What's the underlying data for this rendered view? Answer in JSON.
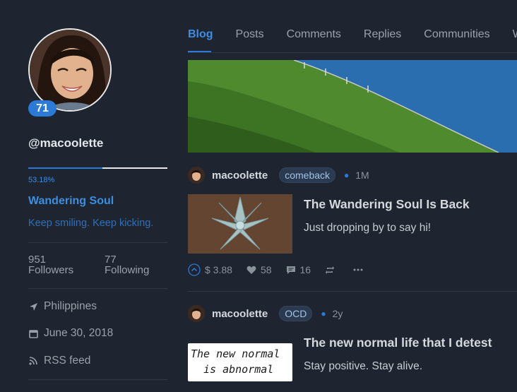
{
  "profile": {
    "reputation": "71",
    "username": "@macoolette",
    "voting_power": 0.5318,
    "voting_power_label": "53.18%",
    "name": "Wandering Soul",
    "about": "Keep smiling. Keep kicking.",
    "followers_count": "951",
    "followers_label": "Followers",
    "following_count": "77",
    "following_label": "Following",
    "location": "Philippines",
    "joined": "June 30, 2018",
    "rss": "RSS feed"
  },
  "tabs": [
    "Blog",
    "Posts",
    "Comments",
    "Replies",
    "Communities",
    "W"
  ],
  "posts": [
    {
      "author": "macoolette",
      "community": "comeback",
      "age": "1M",
      "title": "The Wandering Soul Is Back",
      "body": "Just dropping by to say hi!",
      "payout": "$ 3.88",
      "votes": "58",
      "comments": "16"
    },
    {
      "author": "macoolette",
      "community": "OCD",
      "age": "2y",
      "title": "The new normal life that I detest",
      "body": "Stay positive. Stay alive.",
      "thumb_text_line1": "The new normal",
      "thumb_text_line2": "is abnormal"
    }
  ],
  "colors": {
    "accent": "#2b7ad6",
    "background": "#1e2530"
  },
  "icons": {
    "location": "location-arrow-icon",
    "calendar": "calendar-icon",
    "rss": "rss-icon",
    "upvote": "upvote-icon",
    "heart": "heart-icon",
    "comment": "comment-icon",
    "reblog": "reblog-icon",
    "more": "more-icon"
  }
}
